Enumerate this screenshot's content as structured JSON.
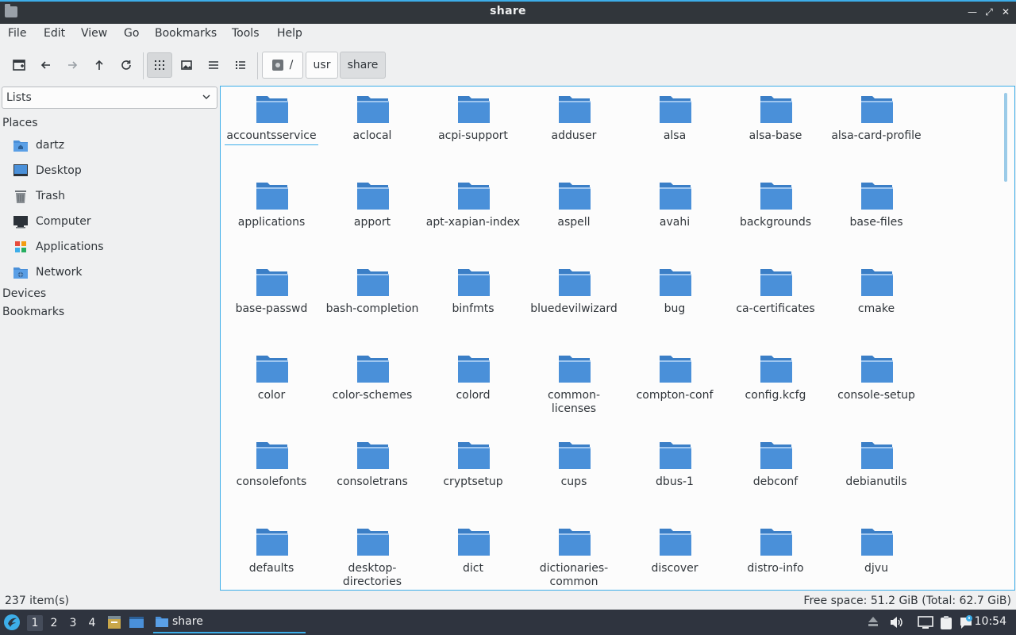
{
  "window": {
    "title": "share",
    "minimize_icon": "minimize-icon",
    "maximize_icon": "restore-icon",
    "close_icon": "close-icon"
  },
  "menu": [
    "File",
    "Edit",
    "View",
    "Go",
    "Bookmarks",
    "Tools",
    "Help"
  ],
  "toolbar": {
    "buttons": [
      "new-tab-icon",
      "back-icon",
      "forward-icon",
      "up-icon",
      "reload-icon",
      "icon-view-icon",
      "thumbnail-view-icon",
      "compact-view-icon",
      "detailed-list-icon"
    ],
    "path": {
      "root": "/",
      "segments": [
        "usr",
        "share"
      ]
    }
  },
  "side": {
    "mode": "Lists",
    "places_label": "Places",
    "places": [
      {
        "label": "dartz",
        "icon": "home-folder-icon"
      },
      {
        "label": "Desktop",
        "icon": "desktop-icon"
      },
      {
        "label": "Trash",
        "icon": "trash-icon"
      },
      {
        "label": "Computer",
        "icon": "computer-icon"
      },
      {
        "label": "Applications",
        "icon": "applications-icon"
      },
      {
        "label": "Network",
        "icon": "network-icon"
      }
    ],
    "devices_label": "Devices",
    "bookmarks_label": "Bookmarks"
  },
  "folders": [
    "accountsservice",
    "aclocal",
    "acpi-support",
    "adduser",
    "alsa",
    "alsa-base",
    "alsa-card-profile",
    "applications",
    "apport",
    "apt-xapian-index",
    "aspell",
    "avahi",
    "backgrounds",
    "base-files",
    "base-passwd",
    "bash-completion",
    "binfmts",
    "bluedevilwizard",
    "bug",
    "ca-certificates",
    "cmake",
    "color",
    "color-schemes",
    "colord",
    "common-licenses",
    "compton-conf",
    "config.kcfg",
    "console-setup",
    "consolefonts",
    "consoletrans",
    "cryptsetup",
    "cups",
    "dbus-1",
    "debconf",
    "debianutils",
    "defaults",
    "desktop-directories",
    "dict",
    "dictionaries-common",
    "discover",
    "distro-info",
    "djvu"
  ],
  "selected_folder": "accountsservice",
  "status": {
    "items": "237 item(s)",
    "free_space": "Free space: 51.2 GiB (Total: 62.7 GiB)"
  },
  "taskbar": {
    "workspaces": [
      "1",
      "2",
      "3",
      "4"
    ],
    "active_workspace": "1",
    "task_label": "share",
    "clock": "10:54"
  },
  "colors": {
    "accent": "#3daee9",
    "folder": "#4a90d9",
    "taskbar": "#2f343f",
    "titlebar": "#31363b"
  }
}
